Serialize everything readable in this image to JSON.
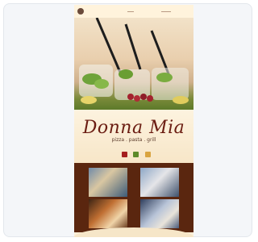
{
  "site": {
    "brand_title": "Donna Mia",
    "brand_tagline": "pizza . pasta . grill"
  },
  "header": {
    "icons": [
      "logo-icon",
      "menu-line-icon",
      "menu-line-icon"
    ]
  },
  "colors": {
    "accent_red": "#a51f1f",
    "accent_green": "#5d8a2a",
    "accent_orange": "#d9a440",
    "brand_brown": "#5a260f"
  }
}
